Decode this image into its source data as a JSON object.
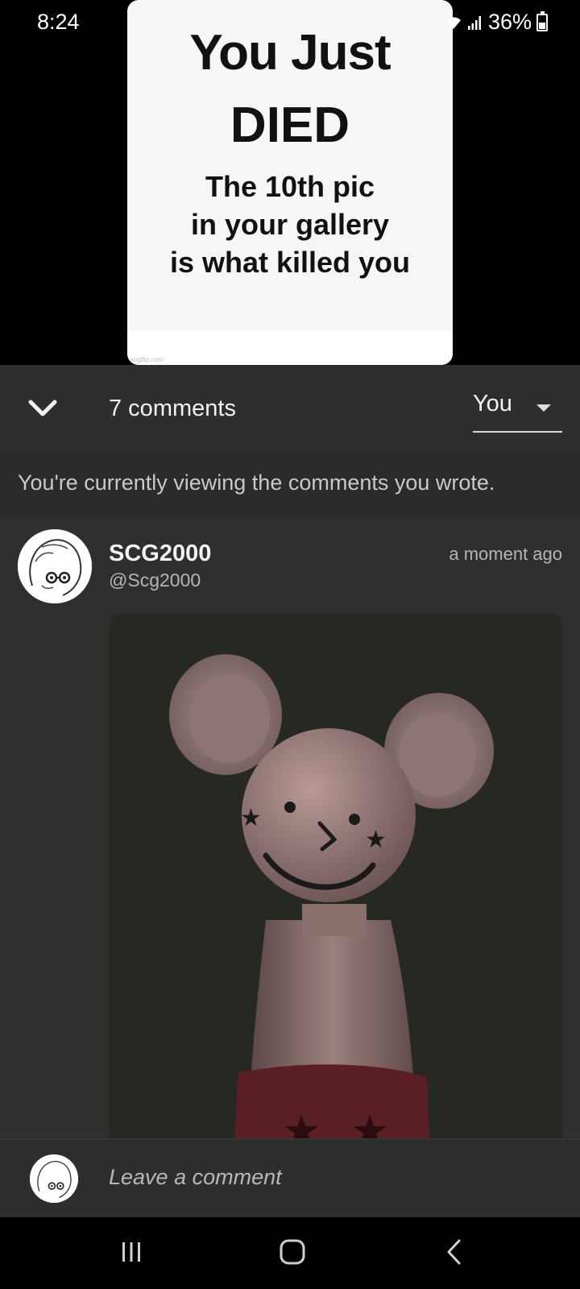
{
  "status_bar": {
    "time": "8:24",
    "battery": "36%",
    "icons": [
      "wifi-icon",
      "signal-icon",
      "battery-icon"
    ]
  },
  "meme": {
    "line1": "You Just",
    "line2": "DIED",
    "subtitle_lines": [
      "The 10th pic",
      "in your gallery",
      "is what killed you"
    ],
    "watermark": "imgflip.com",
    "background": "#f6f6f6"
  },
  "comments_header": {
    "count_label": "7 comments",
    "filter_value": "You",
    "collapse_icon": "chevron-down-icon"
  },
  "notice": {
    "text": "You're currently viewing the comments you wrote."
  },
  "comment": {
    "author": "SCG2000",
    "handle": "@Scg2000",
    "timestamp": "a moment ago"
  },
  "composer": {
    "placeholder": "Leave a comment"
  },
  "nav_bar": {
    "buttons": [
      "recents-icon",
      "home-icon",
      "back-icon"
    ]
  },
  "colors": {
    "panel": "#2d2f2c",
    "notice": "#2a2c29",
    "comment_bg": "#2e302d",
    "attachment_bg": "#262824",
    "text_primary": "#f2f2f2",
    "text_secondary": "#b5b5b5"
  }
}
